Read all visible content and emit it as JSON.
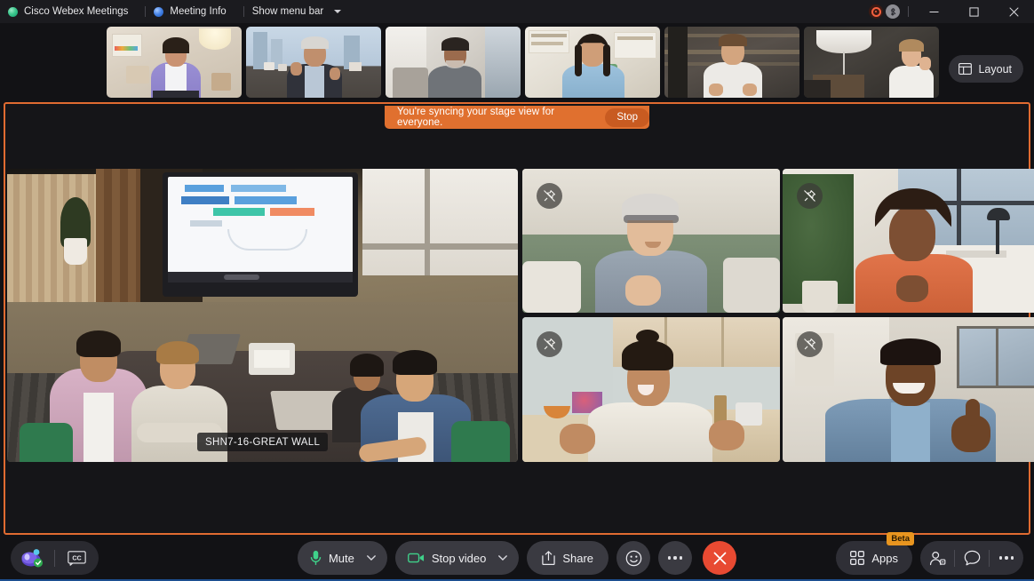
{
  "window": {
    "app_title": "Cisco Webex Meetings",
    "meeting_info": "Meeting Info",
    "show_menu_bar": "Show menu bar",
    "icons": {
      "app_logo": "webex-logo-icon",
      "meeting_info": "info-circle-icon",
      "menu_chevron": "chevron-down-icon",
      "recording": "recording-icon",
      "network": "network-status-icon",
      "minimize": "minimize-icon",
      "maximize": "maximize-icon",
      "close": "close-icon"
    }
  },
  "filmstrip": {
    "layout_button": "Layout",
    "layout_icon": "layout-grid-icon",
    "thumbnails": [
      {
        "name": "participant-thumbnail-1",
        "label": ""
      },
      {
        "name": "participant-thumbnail-2",
        "label": ""
      },
      {
        "name": "participant-thumbnail-3",
        "label": ""
      },
      {
        "name": "participant-thumbnail-4",
        "label": ""
      },
      {
        "name": "participant-thumbnail-5",
        "label": ""
      },
      {
        "name": "participant-thumbnail-6",
        "label": ""
      }
    ]
  },
  "stage": {
    "sync_banner_text": "You're syncing your stage view for everyone.",
    "stop_label": "Stop",
    "main_video_label": "SHN7-16-GREAT WALL",
    "pin_icon": "unpin-icon",
    "tiles": [
      {
        "name": "stage-video-main",
        "pinnable": false
      },
      {
        "name": "stage-video-top-left-small",
        "pinnable": true
      },
      {
        "name": "stage-video-top-right",
        "pinnable": true
      },
      {
        "name": "stage-video-bottom-left-small",
        "pinnable": true
      },
      {
        "name": "stage-video-bottom-right",
        "pinnable": true
      }
    ]
  },
  "toolbar": {
    "assistant_icon": "webex-assistant-icon",
    "captions_icon": "closed-captions-icon",
    "captions_label": "CC",
    "mute_label": "Mute",
    "mute_icon": "microphone-icon",
    "stop_video_label": "Stop video",
    "stop_video_icon": "camera-icon",
    "share_label": "Share",
    "share_icon": "share-screen-icon",
    "reactions_icon": "reactions-smiley-icon",
    "more_icon": "more-horizontal-icon",
    "end_call_icon": "end-call-icon",
    "apps_label": "Apps",
    "apps_icon": "apps-grid-icon",
    "apps_badge": "Beta",
    "participants_icon": "participants-icon",
    "chat_icon": "chat-bubble-icon",
    "more_options_icon": "more-horizontal-icon",
    "caret_icon": "chevron-down-icon"
  },
  "colors": {
    "accent_orange": "#e06b31",
    "banner_orange": "#e0702f",
    "end_call_red": "#e84a32",
    "mic_green": "#3fd18a",
    "beta_amber": "#e8951f",
    "window_bg": "#121215"
  }
}
